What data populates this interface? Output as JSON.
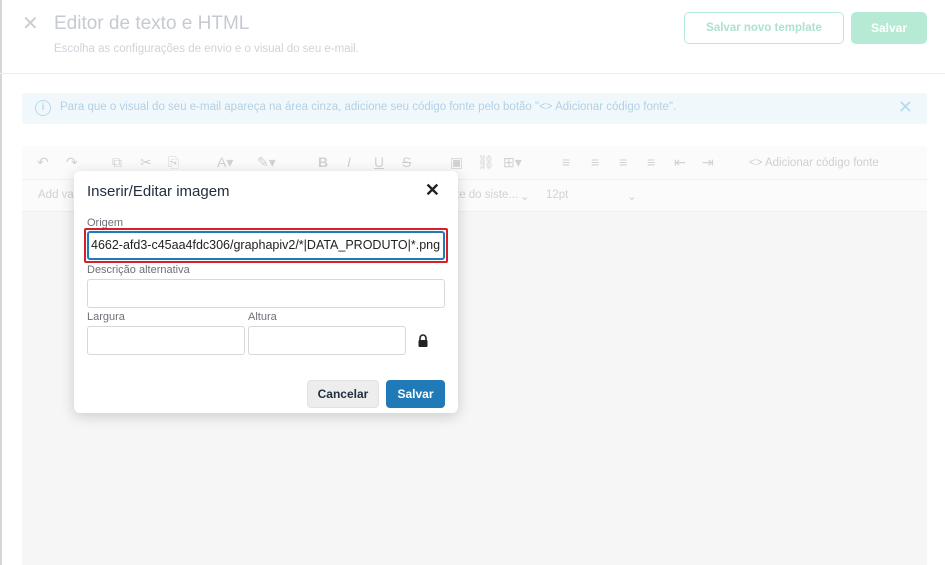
{
  "header": {
    "title": "Editor de texto e HTML",
    "subtitle": "Escolha as configurações de envio e o visual do seu e-mail.",
    "save_template_label": "Salvar novo template",
    "save_label": "Salvar"
  },
  "banner": {
    "text": "Para que o visual do seu e-mail apareça na área cinza, adicione seu código fonte pelo botão \"<> Adicionar código fonte\"."
  },
  "toolbar": {
    "add_source_label": "<> Adicionar código fonte",
    "font_family_partial": "te do siste...",
    "font_size": "12pt",
    "format_partial": "Add var"
  },
  "modal": {
    "title": "Inserir/Editar imagem",
    "source_label": "Origem",
    "source_value": "4662-afd3-c45aa4fdc306/graphapiv2/*|DATA_PRODUTO|*.png",
    "alt_label": "Descrição alternativa",
    "alt_value": "",
    "width_label": "Largura",
    "width_value": "",
    "height_label": "Altura",
    "height_value": "",
    "cancel_label": "Cancelar",
    "save_label": "Salvar"
  },
  "colors": {
    "accent_green": "#b7ead4",
    "primary_blue": "#207ab7",
    "highlight_red": "#d51f2a"
  }
}
